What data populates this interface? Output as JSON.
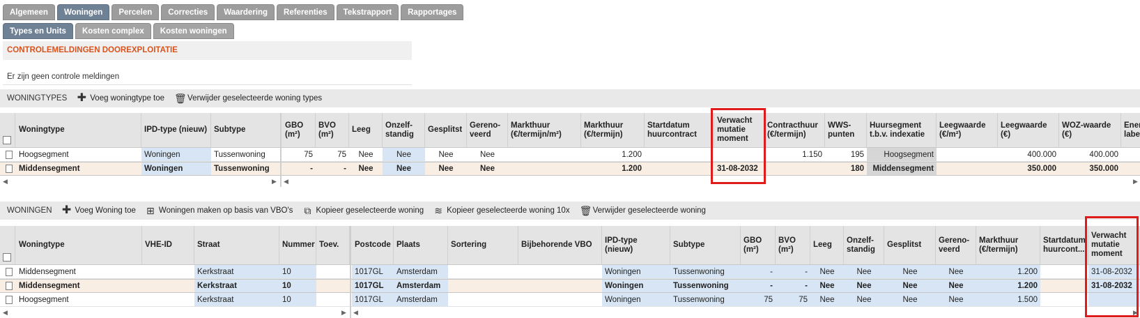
{
  "tabs_main": [
    {
      "label": "Algemeen",
      "active": false
    },
    {
      "label": "Woningen",
      "active": true
    },
    {
      "label": "Percelen",
      "active": false
    },
    {
      "label": "Correcties",
      "active": false
    },
    {
      "label": "Waardering",
      "active": false
    },
    {
      "label": "Referenties",
      "active": false
    },
    {
      "label": "Tekstrapport",
      "active": false
    },
    {
      "label": "Rapportages",
      "active": false
    }
  ],
  "tabs_sub": [
    {
      "label": "Types en Units",
      "active": true
    },
    {
      "label": "Kosten complex",
      "active": false
    },
    {
      "label": "Kosten woningen",
      "active": false
    }
  ],
  "control": {
    "title": "CONTROLEMELDINGEN DOOREXPLOITATIE",
    "message": "Er zijn geen controle meldingen"
  },
  "woningtypes": {
    "title": "WONINGTYPES",
    "add_label": "Voeg woningtype toe",
    "delete_label": "Verwijder geselecteerde woning types",
    "columns": [
      "Woningtype",
      "IPD-type (nieuw)",
      "Subtype",
      "GBO (m²)",
      "BVO (m²)",
      "Leeg",
      "Onzelf-standig",
      "Gesplitst",
      "Gereno-veerd",
      "Markthuur (€/termijn/m²)",
      "Markthuur (€/termijn)",
      "Startdatum huurcontract",
      "Verwacht mutatie moment",
      "Contracthuur (€/termijn)",
      "WWS-punten",
      "Huursegment t.b.v. indexatie",
      "Leegwaarde (€/m²)",
      "Leegwaarde (€)",
      "WOZ-waarde (€)",
      "Energ label"
    ],
    "rows": [
      [
        "Hoogsegment",
        "Woningen",
        "Tussenwoning",
        "75",
        "75",
        "Nee",
        "Nee",
        "Nee",
        "Nee",
        "",
        "1.200",
        "",
        "",
        "1.150",
        "195",
        "Hoogsegment",
        "",
        "400.000",
        "400.000",
        ""
      ],
      [
        "Middensegment",
        "Woningen",
        "Tussenwoning",
        "-",
        "-",
        "Nee",
        "Nee",
        "Nee",
        "Nee",
        "",
        "1.200",
        "",
        "31-08-2032",
        "",
        "180",
        "Middensegment",
        "",
        "350.000",
        "350.000",
        ""
      ]
    ]
  },
  "woningen": {
    "title": "WONINGEN",
    "add_label": "Voeg Woning toe",
    "vbo_label": "Woningen maken op basis van VBO's",
    "copy_label": "Kopieer geselecteerde woning",
    "copy10_label": "Kopieer geselecteerde woning 10x",
    "delete_label": "Verwijder geselecteerde woning",
    "columns": [
      "Woningtype",
      "VHE-ID",
      "Straat",
      "Nummer",
      "Toev.",
      "Postcode",
      "Plaats",
      "Sortering",
      "Bijbehorende VBO",
      "IPD-type (nieuw)",
      "Subtype",
      "GBO (m²)",
      "BVO (m²)",
      "Leeg",
      "Onzelf-standig",
      "Gesplitst",
      "Gereno-veerd",
      "Markthuur (€/termijn)",
      "Startdatum huurcont...",
      "Verwacht mutatie moment"
    ],
    "rows": [
      [
        "Middensegment",
        "",
        "Kerkstraat",
        "10",
        "",
        "1017GL",
        "Amsterdam",
        "",
        "",
        "Woningen",
        "Tussenwoning",
        "-",
        "-",
        "Nee",
        "Nee",
        "Nee",
        "Nee",
        "1.200",
        "",
        "31-08-2032"
      ],
      [
        "Middensegment",
        "",
        "Kerkstraat",
        "10",
        "",
        "1017GL",
        "Amsterdam",
        "",
        "",
        "Woningen",
        "Tussenwoning",
        "-",
        "-",
        "Nee",
        "Nee",
        "Nee",
        "Nee",
        "1.200",
        "",
        "31-08-2032"
      ],
      [
        "Hoogsegment",
        "",
        "Kerkstraat",
        "10",
        "",
        "1017GL",
        "Amsterdam",
        "",
        "",
        "Woningen",
        "Tussenwoning",
        "75",
        "75",
        "Nee",
        "Nee",
        "Nee",
        "Nee",
        "1.500",
        "",
        ""
      ]
    ]
  },
  "colors": {
    "active_tab": "#6f8195",
    "inactive_tab": "#9d9d9d",
    "control_title": "#d9531e",
    "highlight_box": "#e01b1b",
    "selected_row": "#f9eee4",
    "editable_cell": "#d7e5f5"
  },
  "icons": {
    "add": "plus-icon",
    "delete": "trash-icon",
    "vbo": "grid-plus-icon",
    "copy": "copy-icon",
    "copy10": "copy-stack-icon"
  }
}
